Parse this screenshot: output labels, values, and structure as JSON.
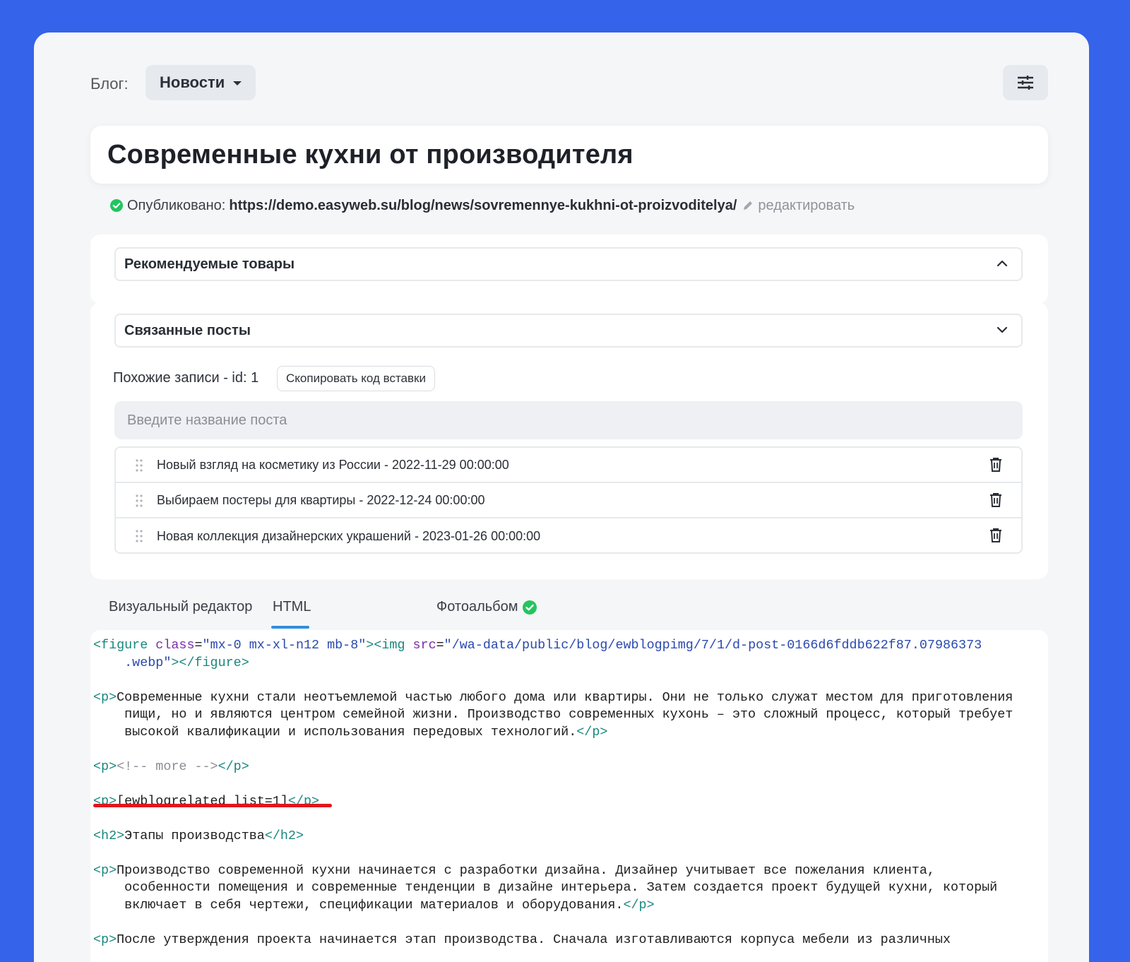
{
  "header": {
    "blog_label": "Блог:",
    "blog_select": "Новости"
  },
  "post": {
    "title": "Современные кухни от производителя",
    "published_label": "Опубликовано:",
    "url": "https://demo.easyweb.su/blog/news/sovremennye-kukhni-ot-proizvoditelya/",
    "edit_label": "редактировать"
  },
  "accordions": {
    "recommended": "Рекомендуемые товары",
    "related": "Связанные посты"
  },
  "related": {
    "similar_label": "Похожие записи - id: 1",
    "copy_button": "Скопировать код вставки",
    "search_placeholder": "Введите название поста",
    "items": [
      {
        "text": "Новый взгляд на косметику из России - 2022-11-29 00:00:00"
      },
      {
        "text": "Выбираем постеры для квартиры - 2022-12-24 00:00:00"
      },
      {
        "text": "Новая коллекция дизайнерских украшений - 2023-01-26 00:00:00"
      }
    ]
  },
  "tabs": {
    "visual": "Визуальный редактор",
    "html": "HTML",
    "photo": "Фотоальбом",
    "active": "HTML"
  },
  "code": {
    "l1_tag_open": "<figure ",
    "l1_attr1": "class",
    "l1_eq1": "=",
    "l1_val1": "\"mx-0 mx-xl-n12 mb-8\"",
    "l1_close1": "><img ",
    "l1_attr2": "src",
    "l1_eq2": "=",
    "l1_val2": "\"/wa-data/public/blog/ewblogpimg/7/1/d-post-0166d6fddb622f87.07986373",
    "l2_val": "    .webp\"",
    "l2_close": "></figure>",
    "p1_open": "<p>",
    "p1_l1": "Современные кухни стали неотъемлемой частью любого дома или квартиры. Они не только служат местом для приготовления",
    "p1_l2": "    пищи, но и являются центром семейной жизни. Производство современных кухонь – это сложный процесс, который требует",
    "p1_l3": "    высокой квалификации и использования передовых технологий.",
    "p_close": "</p>",
    "more_open": "<p>",
    "more_comment": "<!-- more -->",
    "more_close": "</p>",
    "sc_open": "<p>",
    "sc_text": "[ewblogrelated list=1]",
    "sc_close": "</p>",
    "h2_open": "<h2>",
    "h2_text": "Этапы производства",
    "h2_close": "</h2>",
    "p2_open": "<p>",
    "p2_l1": "Производство современной кухни начинается с разработки дизайна. Дизайнер учитывает все пожелания клиента,",
    "p2_l2": "    особенности помещения и современные тенденции в дизайне интерьера. Затем создается проект будущей кухни, который",
    "p2_l3": "    включает в себя чертежи, спецификации материалов и оборудования.",
    "p2_close": "</p>",
    "p3_open": "<p>",
    "p3_l1": "После утверждения проекта начинается этап производства. Сначала изготавливаются корпуса мебели из различных"
  },
  "colors": {
    "background": "#3563e9",
    "accent_tab": "#2f8fe0",
    "success": "#22c55e",
    "highlight_underline": "#e0161d"
  }
}
